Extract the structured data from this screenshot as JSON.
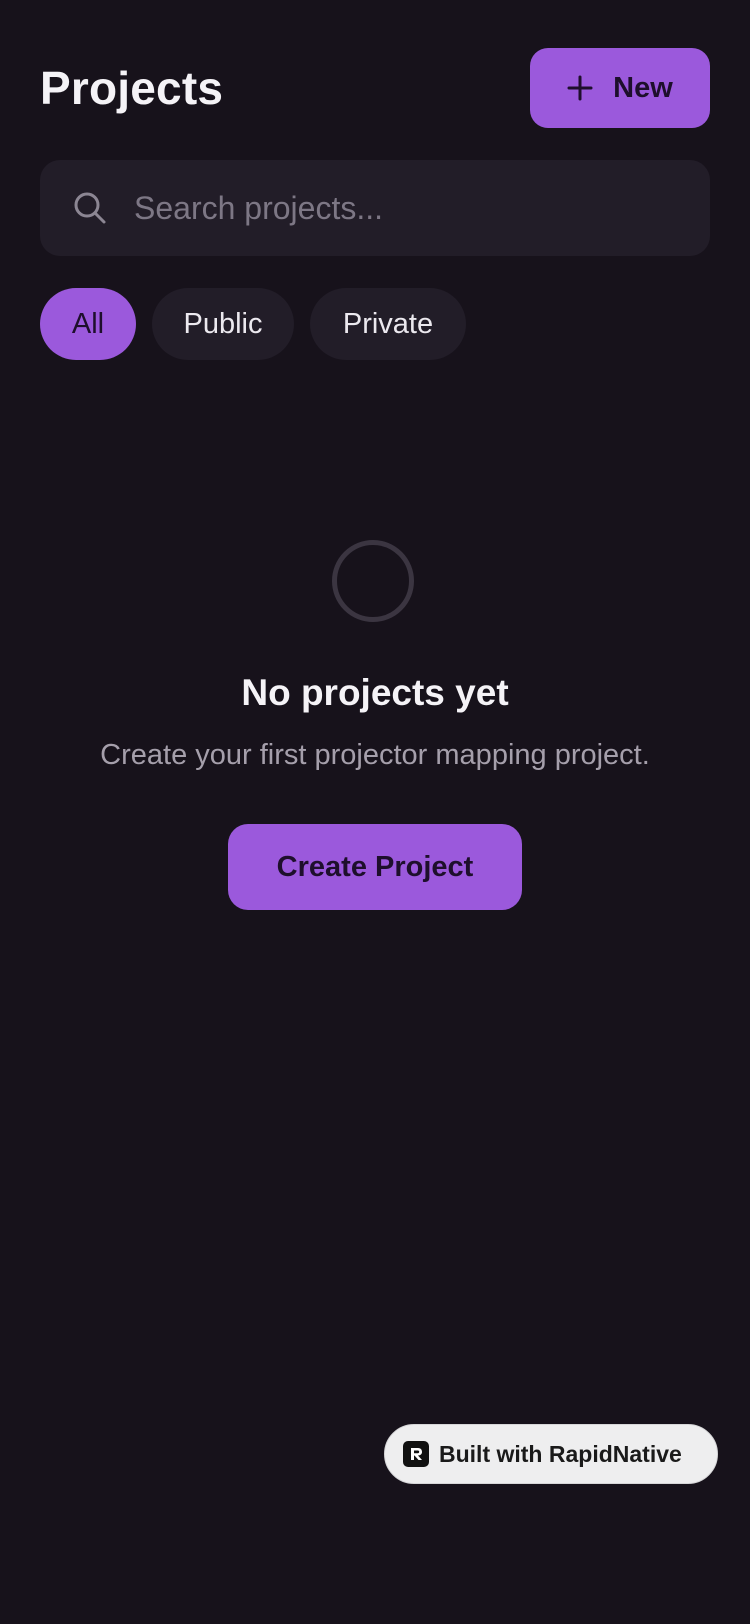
{
  "header": {
    "title": "Projects",
    "new_button_label": "New",
    "new_button_icon": "plus-icon"
  },
  "search": {
    "placeholder": "Search projects...",
    "value": "",
    "icon": "search-icon"
  },
  "filters": {
    "selected": "All",
    "items": [
      {
        "label": "All",
        "active": true
      },
      {
        "label": "Public",
        "active": false
      },
      {
        "label": "Private",
        "active": false
      }
    ]
  },
  "empty_state": {
    "title": "No projects yet",
    "subtitle": "Create your first projector mapping project.",
    "action_label": "Create Project"
  },
  "badge": {
    "label": "Built with RapidNative",
    "icon": "rapidnative-logo-icon"
  },
  "colors": {
    "background": "#17121b",
    "accent": "#9b59dc",
    "surface": "#221d28",
    "accent_text": "#1e0f2c"
  }
}
